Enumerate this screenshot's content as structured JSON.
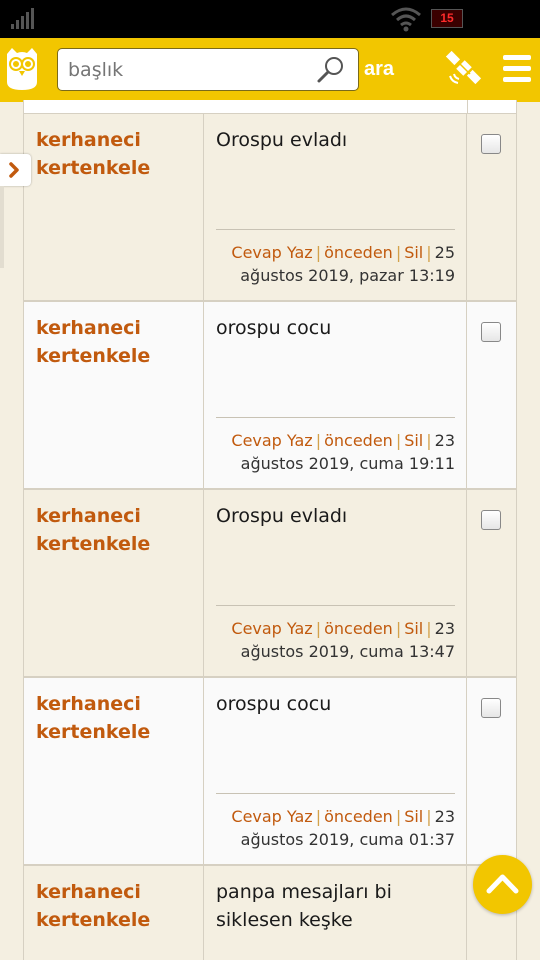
{
  "status_bar": {
    "battery_level": "15"
  },
  "header": {
    "search_placeholder": "başlık",
    "search_button": "ara",
    "brand_color": "#f2c600"
  },
  "entries": [
    {
      "author": "kerhaneci kertenkele",
      "message": "Orospu evladı",
      "reply": "Cevap Yaz",
      "previous": "önceden",
      "delete": "Sil",
      "timestamp": "25 ağustos 2019, pazar 13:19"
    },
    {
      "author": "kerhaneci kertenkele",
      "message": "orospu cocu",
      "reply": "Cevap Yaz",
      "previous": "önceden",
      "delete": "Sil",
      "timestamp": "23 ağustos 2019, cuma 19:11"
    },
    {
      "author": "kerhaneci kertenkele",
      "message": "Orospu evladı",
      "reply": "Cevap Yaz",
      "previous": "önceden",
      "delete": "Sil",
      "timestamp": "23 ağustos 2019, cuma 13:47"
    },
    {
      "author": "kerhaneci kertenkele",
      "message": "orospu cocu",
      "reply": "Cevap Yaz",
      "previous": "önceden",
      "delete": "Sil",
      "timestamp": "23 ağustos 2019, cuma 01:37"
    },
    {
      "author": "kerhaneci kertenkele",
      "message": "panpa mesajları bi siklesen keşke"
    }
  ],
  "icons": {
    "logo": "owl-logo-icon",
    "search": "search-icon",
    "satellite": "satellite-icon",
    "menu": "menu-icon",
    "side_toggle": "chevron-right-icon",
    "scroll_top": "chevron-up-icon"
  }
}
